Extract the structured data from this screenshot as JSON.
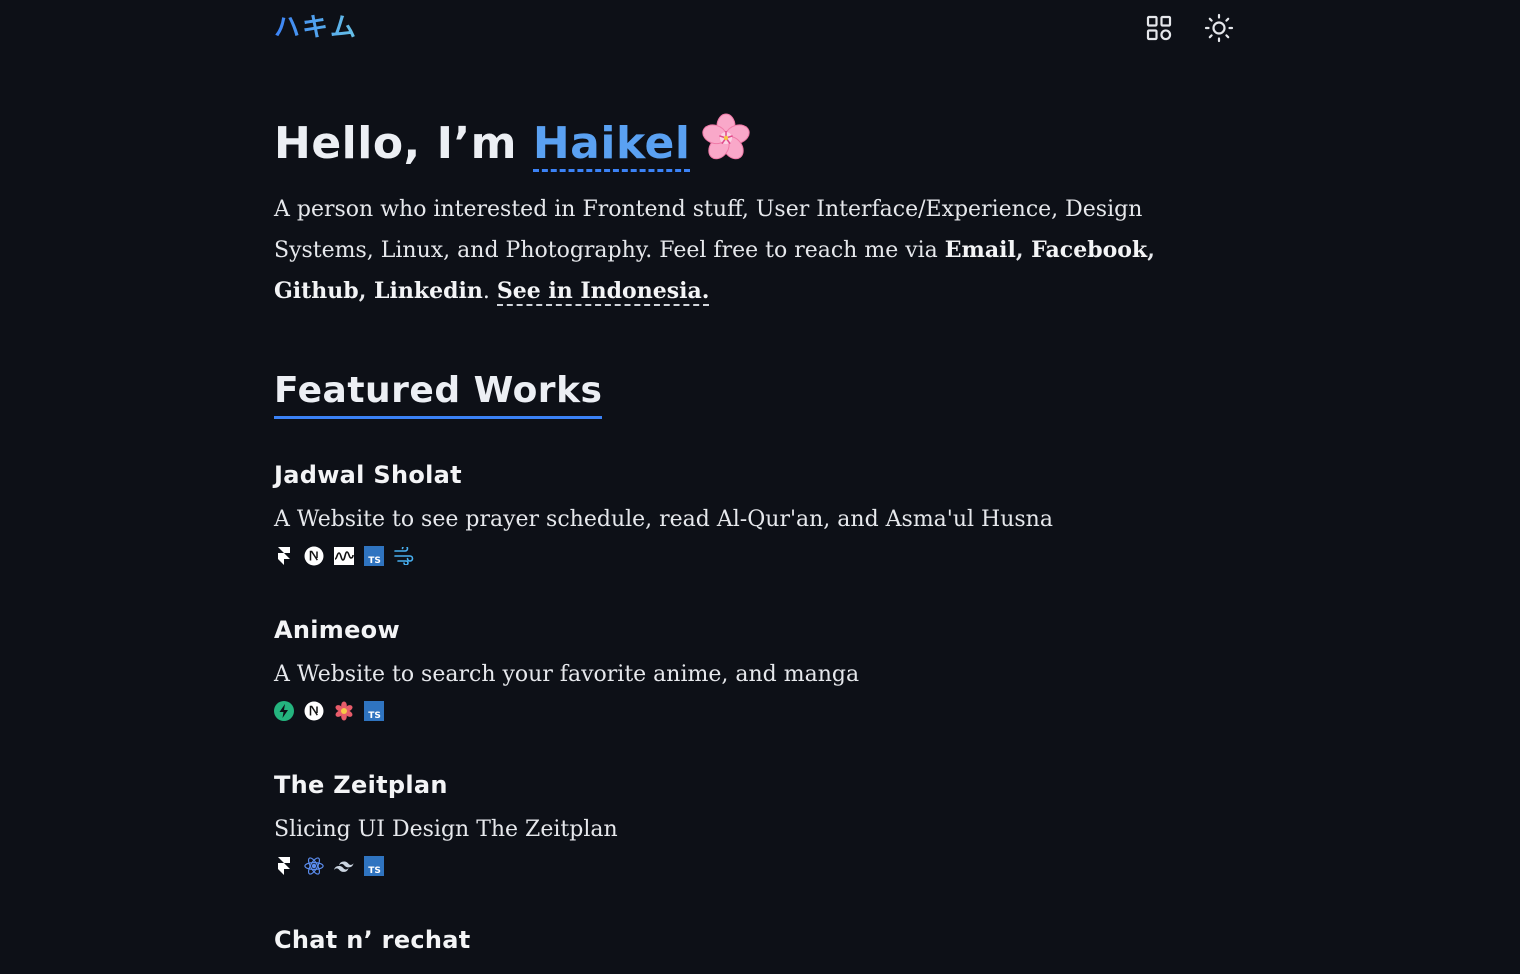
{
  "header": {
    "logo": "ハキム",
    "grid_icon": "grid-icon",
    "theme_icon": "sun-icon"
  },
  "hero": {
    "greeting": "Hello, I’m ",
    "name": "Haikel",
    "emoji": "cherry-blossom-icon"
  },
  "intro": {
    "text": "A person who interested in Frontend stuff, User Interface/Experience, Design Systems, Linux, and Photography. Feel free to reach me via ",
    "links": [
      "Email",
      "Facebook",
      "Github",
      "Linkedin"
    ],
    "sep": ", ",
    "end": ". ",
    "see_indonesia": "See in Indonesia."
  },
  "featured": {
    "title": "Featured Works",
    "projects": [
      {
        "title": "Jadwal Sholat",
        "description": "A Website to see prayer schedule, read Al-Qur'an, and Asma'ul Husna",
        "tech": [
          "framer-icon",
          "nextjs-icon",
          "swr-icon",
          "typescript-icon",
          "windicss-icon"
        ]
      },
      {
        "title": "Animeow",
        "description": "A Website to search your favorite anime, and manga",
        "tech": [
          "supabase-icon",
          "nextjs-icon",
          "recoil-icon",
          "typescript-icon"
        ]
      },
      {
        "title": "The Zeitplan",
        "description": "Slicing UI Design The Zeitplan",
        "tech": [
          "framer-icon",
          "react-icon",
          "tailwind-icon",
          "typescript-icon"
        ]
      },
      {
        "title": "Chat n’ rechat",
        "description": "",
        "tech": []
      }
    ]
  },
  "colors": {
    "background": "#0d1017",
    "accent": "#3b82f6",
    "name": "#5aa1f2",
    "text": "#eceff4"
  }
}
